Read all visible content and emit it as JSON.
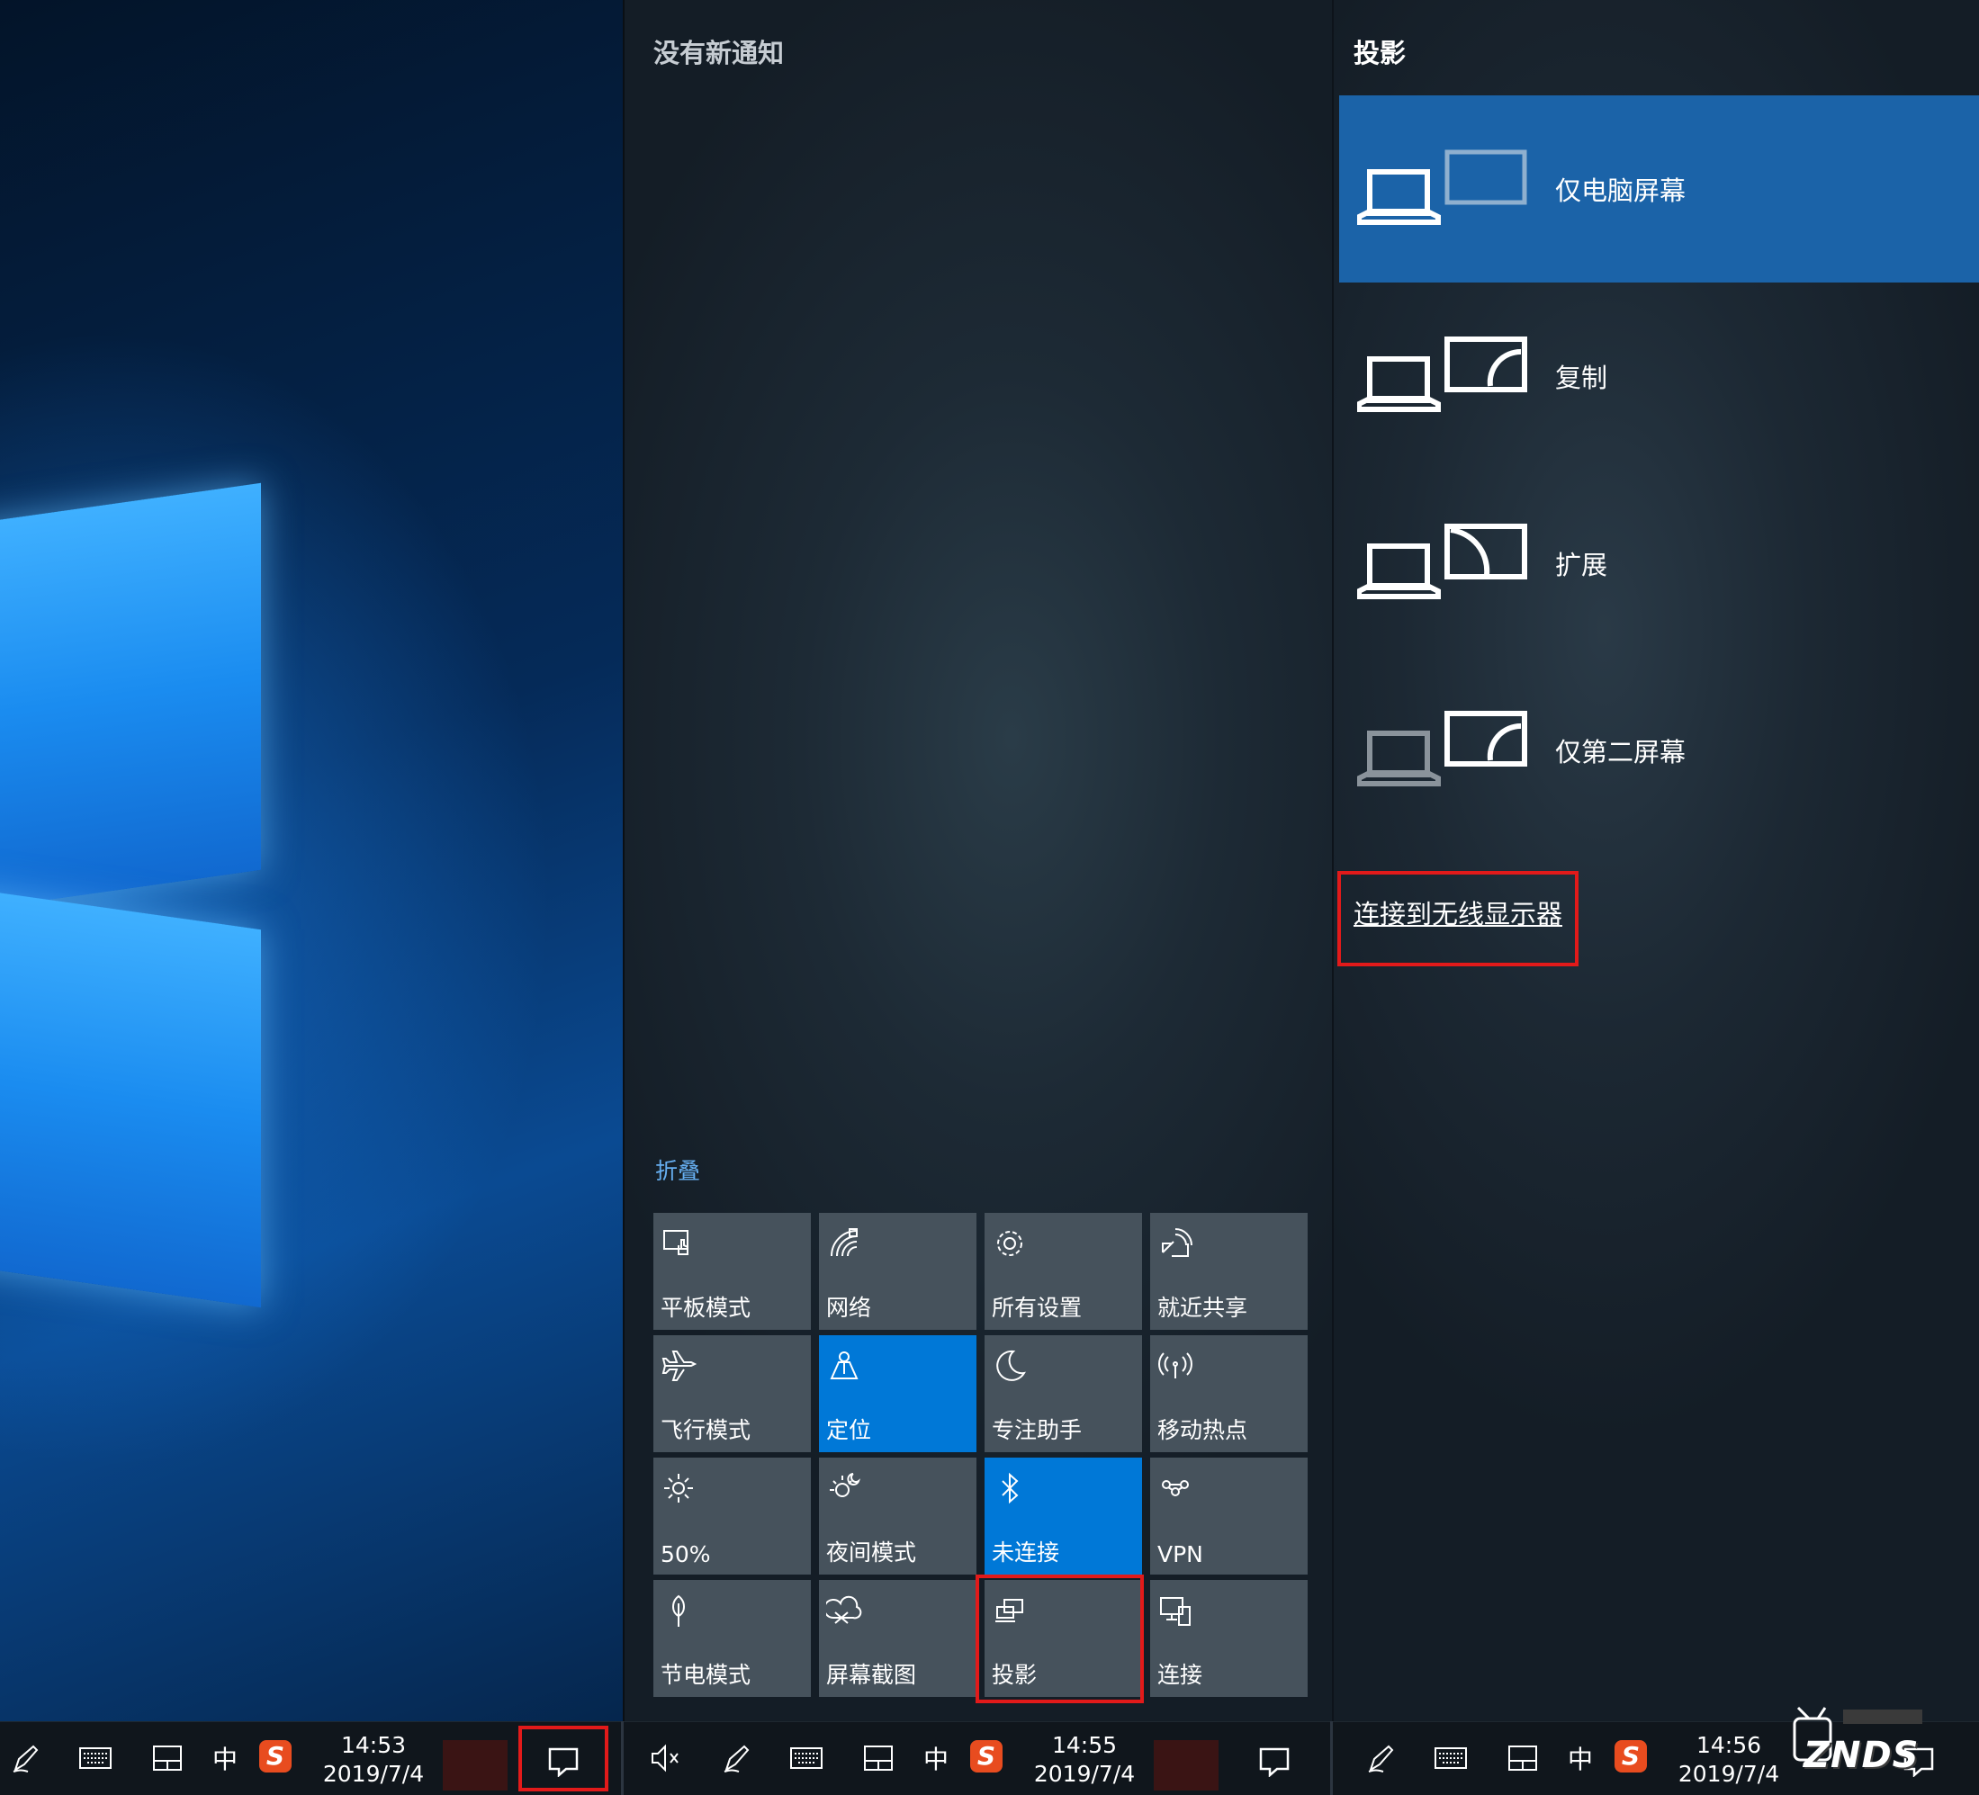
{
  "action_center": {
    "heading": "没有新通知",
    "collapse_label": "折叠",
    "tiles": [
      {
        "label": "平板模式",
        "icon": "tablet-mode-icon",
        "active": false
      },
      {
        "label": "网络",
        "icon": "network-icon",
        "active": false
      },
      {
        "label": "所有设置",
        "icon": "gear-icon",
        "active": false
      },
      {
        "label": "就近共享",
        "icon": "nearby-share-icon",
        "active": false
      },
      {
        "label": "飞行模式",
        "icon": "airplane-icon",
        "active": false
      },
      {
        "label": "定位",
        "icon": "location-icon",
        "active": true
      },
      {
        "label": "专注助手",
        "icon": "moon-icon",
        "active": false
      },
      {
        "label": "移动热点",
        "icon": "hotspot-icon",
        "active": false
      },
      {
        "label": "50%",
        "icon": "brightness-icon",
        "active": false
      },
      {
        "label": "夜间模式",
        "icon": "night-light-icon",
        "active": false
      },
      {
        "label": "未连接",
        "icon": "bluetooth-icon",
        "active": true
      },
      {
        "label": "VPN",
        "icon": "vpn-icon",
        "active": false
      },
      {
        "label": "节电模式",
        "icon": "battery-saver-icon",
        "active": false
      },
      {
        "label": "屏幕截图",
        "icon": "screen-snip-icon",
        "active": false
      },
      {
        "label": "投影",
        "icon": "project-icon",
        "active": false
      },
      {
        "label": "连接",
        "icon": "connect-icon",
        "active": false
      }
    ]
  },
  "project": {
    "heading": "投影",
    "options": [
      {
        "label": "仅电脑屏幕",
        "icon": "pc-screen-only-icon",
        "selected": true
      },
      {
        "label": "复制",
        "icon": "duplicate-icon",
        "selected": false
      },
      {
        "label": "扩展",
        "icon": "extend-icon",
        "selected": false
      },
      {
        "label": "仅第二屏幕",
        "icon": "second-screen-only-icon",
        "selected": false
      }
    ],
    "wireless_link": "连接到无线显示器"
  },
  "taskbars": [
    {
      "time": "14:53",
      "date": "2019/7/4",
      "ime": "中",
      "ime_brand": "S"
    },
    {
      "time": "14:55",
      "date": "2019/7/4",
      "ime": "中",
      "ime_brand": "S"
    },
    {
      "time": "14:56",
      "date": "2019/7/4",
      "ime": "中",
      "ime_brand": "S"
    }
  ],
  "watermark": "ZNDS",
  "colors": {
    "accent": "#0078d7",
    "selected_option": "#1b63a8",
    "highlight_box": "#e21a1a",
    "tile": "#46525c"
  }
}
